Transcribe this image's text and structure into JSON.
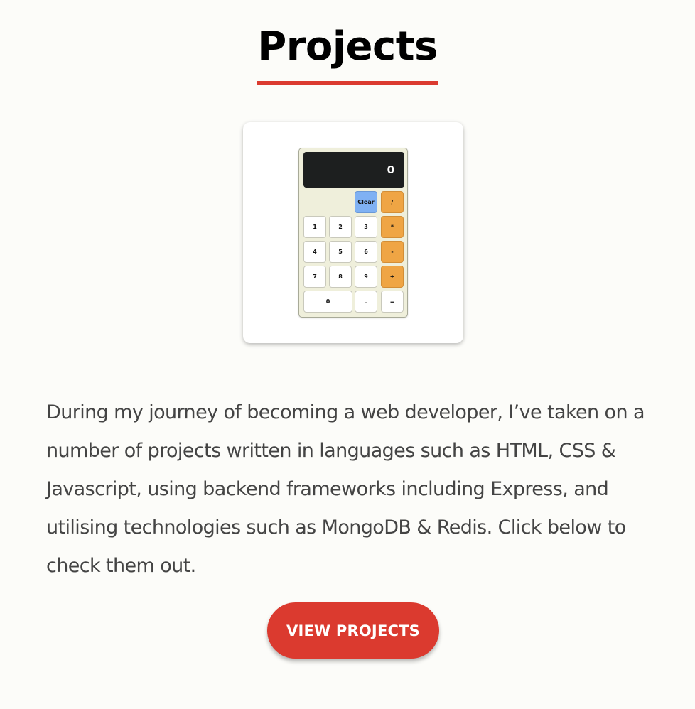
{
  "section": {
    "title": "Projects",
    "accent_color": "#db3b30",
    "description": "During my journey of becoming a web developer, I’ve taken on a number of projects written in languages such as HTML, CSS & Javascript, using backend frameworks including Express, and utilising technologies such as MongoDB & Redis. Click below to check them out.",
    "button_label": "VIEW PROJECTS"
  },
  "calculator_preview": {
    "display_value": "0",
    "keys": [
      "Clear",
      "/",
      "1",
      "2",
      "3",
      "*",
      "4",
      "5",
      "6",
      "-",
      "7",
      "8",
      "9",
      "+",
      "0",
      ".",
      "="
    ],
    "colors": {
      "operator": "#efa544",
      "clear": "#7fb1f3",
      "display": "#1d1f1f",
      "body": "#efefdb"
    }
  }
}
